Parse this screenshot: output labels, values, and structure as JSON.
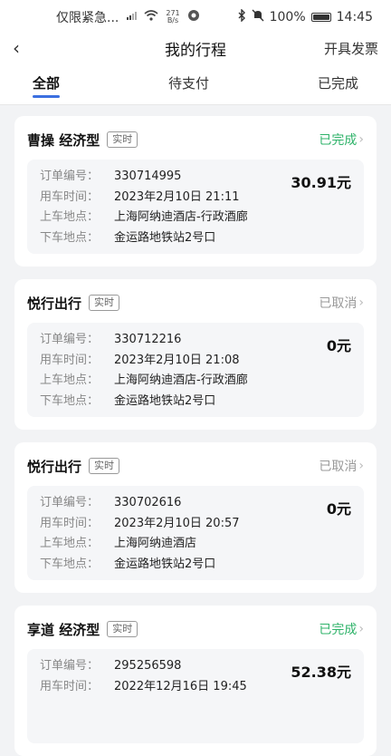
{
  "status_bar": {
    "notice": "仅限紧急...",
    "net_speed_value": "271",
    "net_speed_unit": "B/s",
    "battery": "100%",
    "time": "14:45"
  },
  "header": {
    "title": "我的行程",
    "right_action": "开具发票"
  },
  "tabs": [
    {
      "label": "全部",
      "active": true
    },
    {
      "label": "待支付",
      "active": false
    },
    {
      "label": "已完成",
      "active": false
    }
  ],
  "labels": {
    "order_no": "订单编号：",
    "time": "用车时间：",
    "pickup": "上车地点：",
    "dropoff": "下车地点："
  },
  "orders": [
    {
      "provider": "曹操 经济型",
      "badge": "实时",
      "status": "已完成",
      "status_type": "done",
      "order_no": "330714995",
      "time": "2023年2月10日 21:11",
      "pickup": "上海阿纳迪酒店-行政酒廊",
      "dropoff": "金运路地铁站2号口",
      "price": "30.91元"
    },
    {
      "provider": "悦行出行",
      "badge": "实时",
      "status": "已取消",
      "status_type": "cancel",
      "order_no": "330712216",
      "time": "2023年2月10日 21:08",
      "pickup": "上海阿纳迪酒店-行政酒廊",
      "dropoff": "金运路地铁站2号口",
      "price": "0元"
    },
    {
      "provider": "悦行出行",
      "badge": "实时",
      "status": "已取消",
      "status_type": "cancel",
      "order_no": "330702616",
      "time": "2023年2月10日 20:57",
      "pickup": "上海阿纳迪酒店",
      "dropoff": "金运路地铁站2号口",
      "price": "0元"
    },
    {
      "provider": "享道 经济型",
      "badge": "实时",
      "status": "已完成",
      "status_type": "done",
      "order_no": "295256598",
      "time": "2022年12月16日 19:45",
      "pickup": "",
      "dropoff": "",
      "price": "52.38元"
    }
  ],
  "colors": {
    "accent": "#3b6fe0",
    "done": "#2fb36a",
    "cancel": "#999999"
  }
}
